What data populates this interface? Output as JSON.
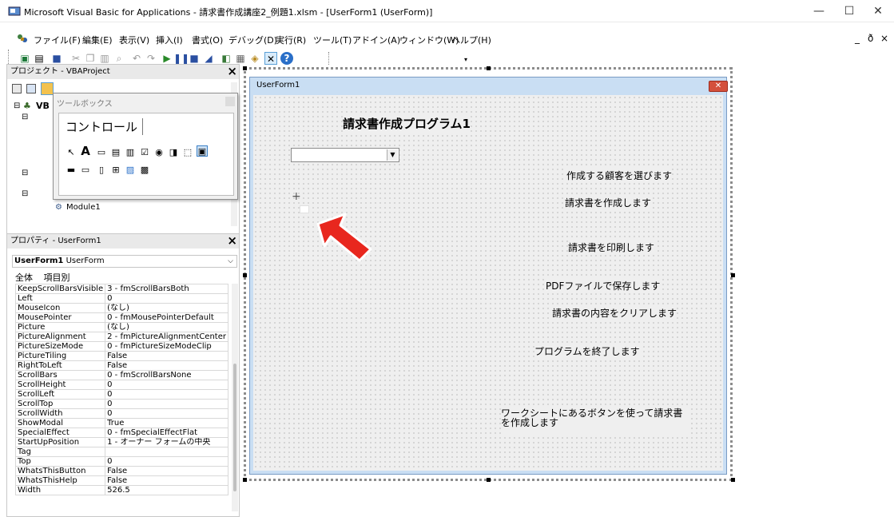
{
  "window": {
    "title": "Microsoft Visual Basic for Applications - 請求書作成講座2_例題1.xlsm - [UserForm1 (UserForm)]",
    "min_label": "—",
    "max_label": "☐",
    "close_label": "✕"
  },
  "menu": {
    "items": [
      "ファイル(F)",
      "編集(E)",
      "表示(V)",
      "挿入(I)",
      "書式(O)",
      "デバッグ(D)",
      "実行(R)",
      "ツール(T)",
      "アドイン(A)",
      "ウィンドウ(W)",
      "ヘルプ(H)"
    ],
    "right_controls": [
      "_",
      "ð",
      "×"
    ]
  },
  "toolbar": {
    "buttons": [
      "excel-icon",
      "insert-icon",
      "save-icon",
      "cut-icon",
      "copy-icon",
      "paste-icon",
      "find-icon",
      "undo-icon",
      "redo-icon",
      "run-icon",
      "break-icon",
      "reset-icon",
      "design-mode-icon",
      "project-explorer-icon",
      "properties-icon",
      "object-browser-icon",
      "toolbox-icon",
      "help-icon"
    ]
  },
  "project_panel": {
    "title": "プロジェクト - VBAProject",
    "close": "×",
    "tree_root": "VB",
    "module": "Module1"
  },
  "toolbox": {
    "title": "ツールボックス",
    "tab": "コントロール"
  },
  "properties_panel": {
    "title": "プロパティ - UserForm1",
    "close": "×",
    "object_name": "UserForm1",
    "object_type": "UserForm",
    "tabs": [
      "全体",
      "項目別"
    ],
    "rows": [
      [
        "KeepScrollBarsVisible",
        "3 - fmScrollBarsBoth"
      ],
      [
        "Left",
        "0"
      ],
      [
        "MouseIcon",
        "(なし)"
      ],
      [
        "MousePointer",
        "0 - fmMousePointerDefault"
      ],
      [
        "Picture",
        "(なし)"
      ],
      [
        "PictureAlignment",
        "2 - fmPictureAlignmentCenter"
      ],
      [
        "PictureSizeMode",
        "0 - fmPictureSizeModeClip"
      ],
      [
        "PictureTiling",
        "False"
      ],
      [
        "RightToLeft",
        "False"
      ],
      [
        "ScrollBars",
        "0 - fmScrollBarsNone"
      ],
      [
        "ScrollHeight",
        "0"
      ],
      [
        "ScrollLeft",
        "0"
      ],
      [
        "ScrollTop",
        "0"
      ],
      [
        "ScrollWidth",
        "0"
      ],
      [
        "ShowModal",
        "True"
      ],
      [
        "SpecialEffect",
        "0 - fmSpecialEffectFlat"
      ],
      [
        "StartUpPosition",
        "1 - オーナー フォームの中央"
      ],
      [
        "Tag",
        ""
      ],
      [
        "Top",
        "0"
      ],
      [
        "WhatsThisButton",
        "False"
      ],
      [
        "WhatsThisHelp",
        "False"
      ],
      [
        "Width",
        "526.5"
      ]
    ]
  },
  "userform": {
    "caption": "UserForm1",
    "close": "✕",
    "heading": "請求書作成プログラム1",
    "labels": [
      "作成する顧客を選びます",
      "請求書を作成します",
      "請求書を印刷します",
      "PDFファイルで保存します",
      "請求書の内容をクリアします",
      "プログラムを終了します",
      "ワークシートにあるボタンを使って請求書を作成します"
    ],
    "combo_value": ""
  },
  "colors": {
    "accent_arrow": "#e8271e",
    "form_title_bg": "#c9def3",
    "form_close": "#d4503c"
  }
}
